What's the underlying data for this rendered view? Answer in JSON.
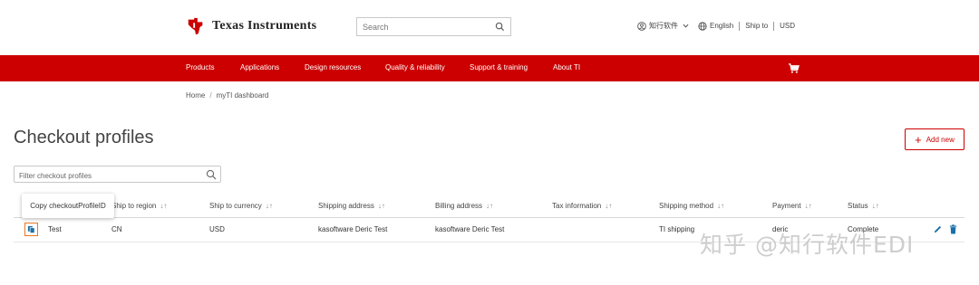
{
  "header": {
    "brand": "Texas Instruments",
    "search_placeholder": "Search",
    "user_label": "知行软件",
    "language": "English",
    "ship_to": "Ship to",
    "currency": "USD"
  },
  "nav": {
    "items": [
      "Products",
      "Applications",
      "Design resources",
      "Quality & reliability",
      "Support & training",
      "About TI"
    ]
  },
  "breadcrumb": {
    "home": "Home",
    "sep": "/",
    "current": "myTI dashboard"
  },
  "page": {
    "title": "Checkout profiles",
    "add_label": "Add new",
    "filter_placeholder": "Filter checkout profiles"
  },
  "table": {
    "columns": [
      "Ship to region",
      "Ship to currency",
      "Shipping address",
      "Billing address",
      "Tax information",
      "Shipping method",
      "Payment",
      "Status"
    ],
    "sort_glyph": "↓↑",
    "tooltip": "Copy checkoutProfileID",
    "rows": [
      {
        "name": "Test",
        "region": "CN",
        "currency": "USD",
        "shipping_address": "kasoftware Deric Test",
        "billing_address": "kasoftware Deric Test",
        "tax_information": "",
        "shipping_method": "TI shipping",
        "payment": "deric",
        "status": "Complete"
      }
    ]
  },
  "watermark": "知乎 @知行软件EDI",
  "colors": {
    "brand_red": "#cc0000",
    "copy_border": "#e87722",
    "action_blue": "#1a6fa8"
  }
}
